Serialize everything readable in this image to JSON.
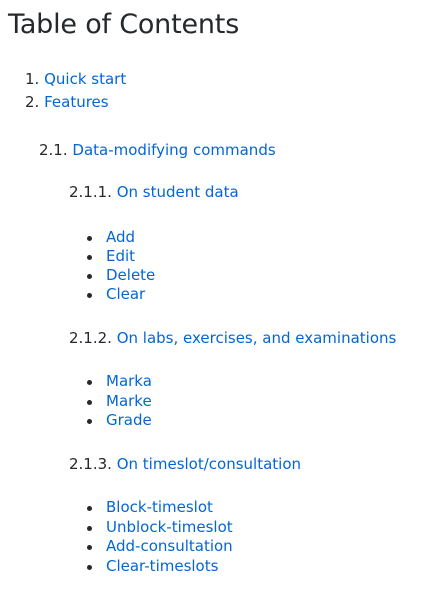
{
  "title": "Table of Contents",
  "items": {
    "quick_start": {
      "num": "1.",
      "label": "Quick start"
    },
    "features": {
      "num": "2.",
      "label": "Features"
    },
    "data_modifying": {
      "num": "2.1.",
      "label": "Data-modifying commands"
    },
    "student_data": {
      "num": "2.1.1.",
      "label": "On student data"
    },
    "student_cmds": [
      "Add",
      "Edit",
      "Delete",
      "Clear"
    ],
    "labs": {
      "num": "2.1.2.",
      "label": "On labs, exercises, and examinations"
    },
    "labs_cmds": [
      "Marka",
      "Marke",
      "Grade"
    ],
    "timeslot": {
      "num": "2.1.3.",
      "label": "On timeslot/consultation"
    },
    "timeslot_cmds": [
      "Block-timeslot",
      "Unblock-timeslot",
      "Add-consultation",
      "Clear-timeslots"
    ]
  }
}
